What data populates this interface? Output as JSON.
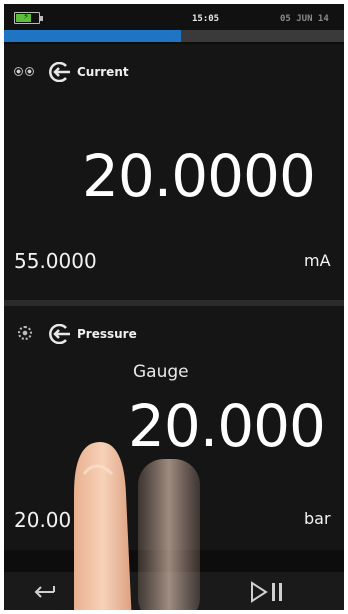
{
  "status_bar": {
    "time": "15:05",
    "date": "05 JUN 14",
    "battery_level": 0.7,
    "battery_color": "#5bbf3a"
  },
  "progress": {
    "value": 0.52,
    "color": "#1f74c4"
  },
  "panel_current": {
    "label": "Current",
    "reading": "20.0000",
    "secondary": "55.0000",
    "unit": "mA",
    "icons": [
      "eye-pair-icon",
      "source-arrow-icon"
    ]
  },
  "panel_pressure": {
    "label": "Pressure",
    "mode": "Gauge",
    "reading": "20.000",
    "secondary": "20.00",
    "unit": "bar",
    "icons": [
      "gear-icon",
      "source-arrow-icon"
    ]
  },
  "toolbar": {
    "icons": [
      "back-arrow-icon",
      "play-pause-icon"
    ]
  }
}
